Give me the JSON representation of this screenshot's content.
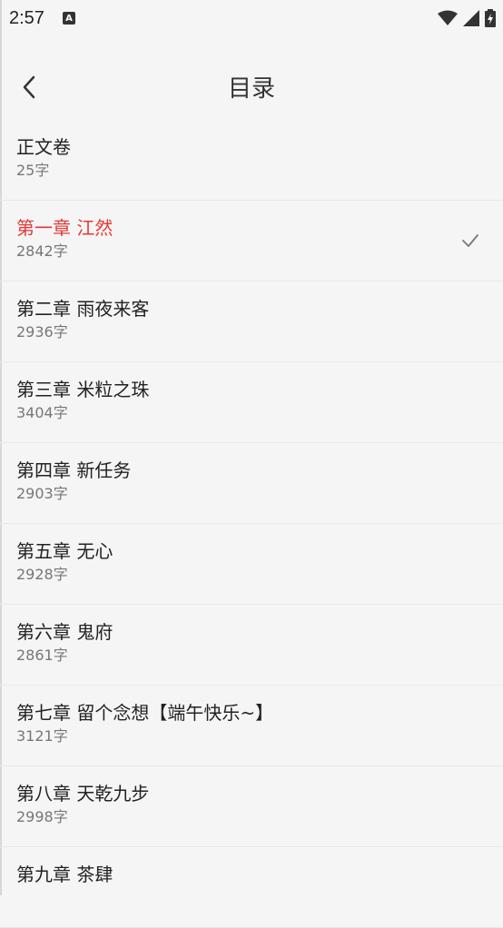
{
  "status": {
    "time": "2:57",
    "notif_letter": "A"
  },
  "header": {
    "title": "目录"
  },
  "chapters": [
    {
      "title": "正文卷",
      "count": "25字"
    },
    {
      "title": "第一章 江然",
      "count": "2842字",
      "active": true
    },
    {
      "title": "第二章 雨夜来客",
      "count": "2936字"
    },
    {
      "title": "第三章 米粒之珠",
      "count": "3404字"
    },
    {
      "title": "第四章 新任务",
      "count": "2903字"
    },
    {
      "title": "第五章 无心",
      "count": "2928字"
    },
    {
      "title": "第六章 鬼府",
      "count": "2861字"
    },
    {
      "title": "第七章 留个念想【端午快乐~】",
      "count": "3121字"
    },
    {
      "title": "第八章 天乾九步",
      "count": "2998字"
    },
    {
      "title": "第九章 茶肆",
      "count": ""
    }
  ],
  "colors": {
    "active": "#e53935",
    "background": "#f5f5f5"
  }
}
